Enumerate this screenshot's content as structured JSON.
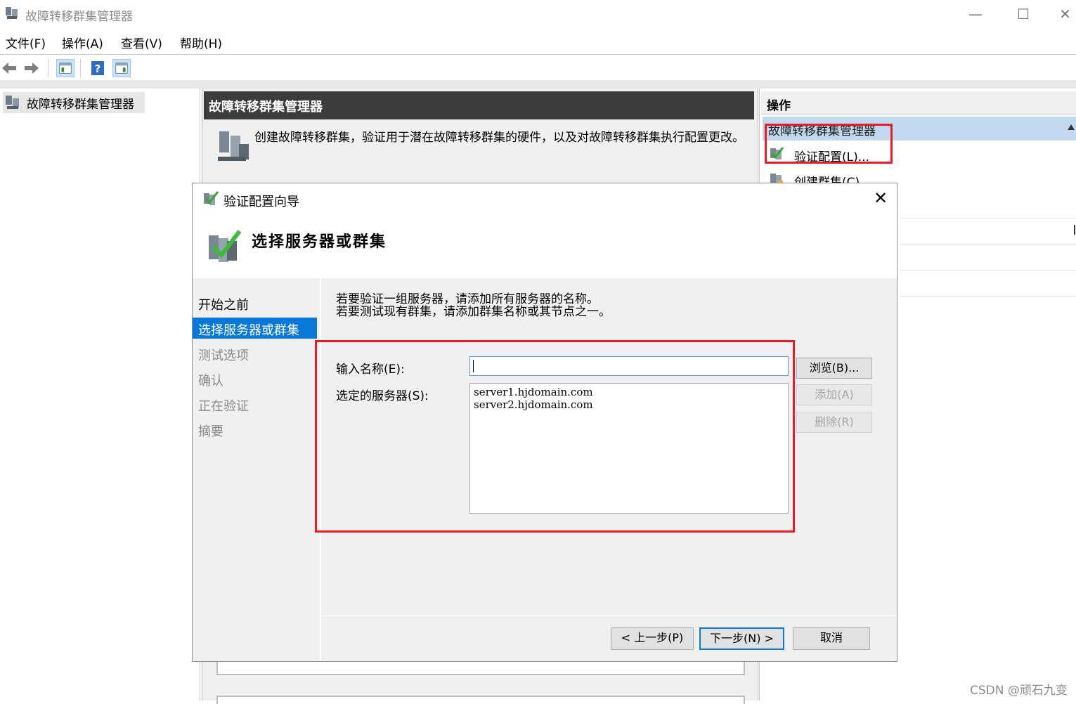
{
  "window": {
    "title": "故障转移群集管理器",
    "minimize": "—",
    "maximize": "☐",
    "close": "✕"
  },
  "menu": {
    "items": [
      "文件(F)",
      "操作(A)",
      "查看(V)",
      "帮助(H)"
    ]
  },
  "tree": {
    "root_label": "故障转移群集管理器"
  },
  "center": {
    "header": "故障转移群集管理器",
    "description": "创建故障转移群集，验证用于潜在故障转移群集的硬件，以及对故障转移群集执行配置更改。"
  },
  "actions": {
    "title": "操作",
    "group": "故障转移群集管理器",
    "items": [
      "验证配置(L)...",
      "创建群集(C)..."
    ]
  },
  "dialog": {
    "title": "验证配置向导",
    "close": "✕",
    "heading": "选择服务器或群集",
    "nav": [
      "开始之前",
      "选择服务器或群集",
      "测试选项",
      "确认",
      "正在验证",
      "摘要"
    ],
    "selected_nav": "选择服务器或群集",
    "intro_line1": "若要验证一组服务器，请添加所有服务器的名称。",
    "intro_line2": "若要测试现有群集，请添加群集名称或其节点之一。",
    "name_label": "输入名称(E):",
    "name_value": "",
    "selected_label": "选定的服务器(S):",
    "servers": [
      "server1.hjdomain.com",
      "server2.hjdomain.com"
    ],
    "browse_button": "浏览(B)...",
    "add_button": "添加(A)",
    "remove_button": "删除(R)",
    "back_button": "< 上一步(P)",
    "next_button": "下一步(N) >",
    "cancel_button": "取消"
  },
  "watermark": "CSDN @顽石九变",
  "colors": {
    "selection": "#0a78d7",
    "highlight": "#ea1b24",
    "header_dark": "#3c3c3c",
    "actions_group": "#c2d8ee"
  }
}
